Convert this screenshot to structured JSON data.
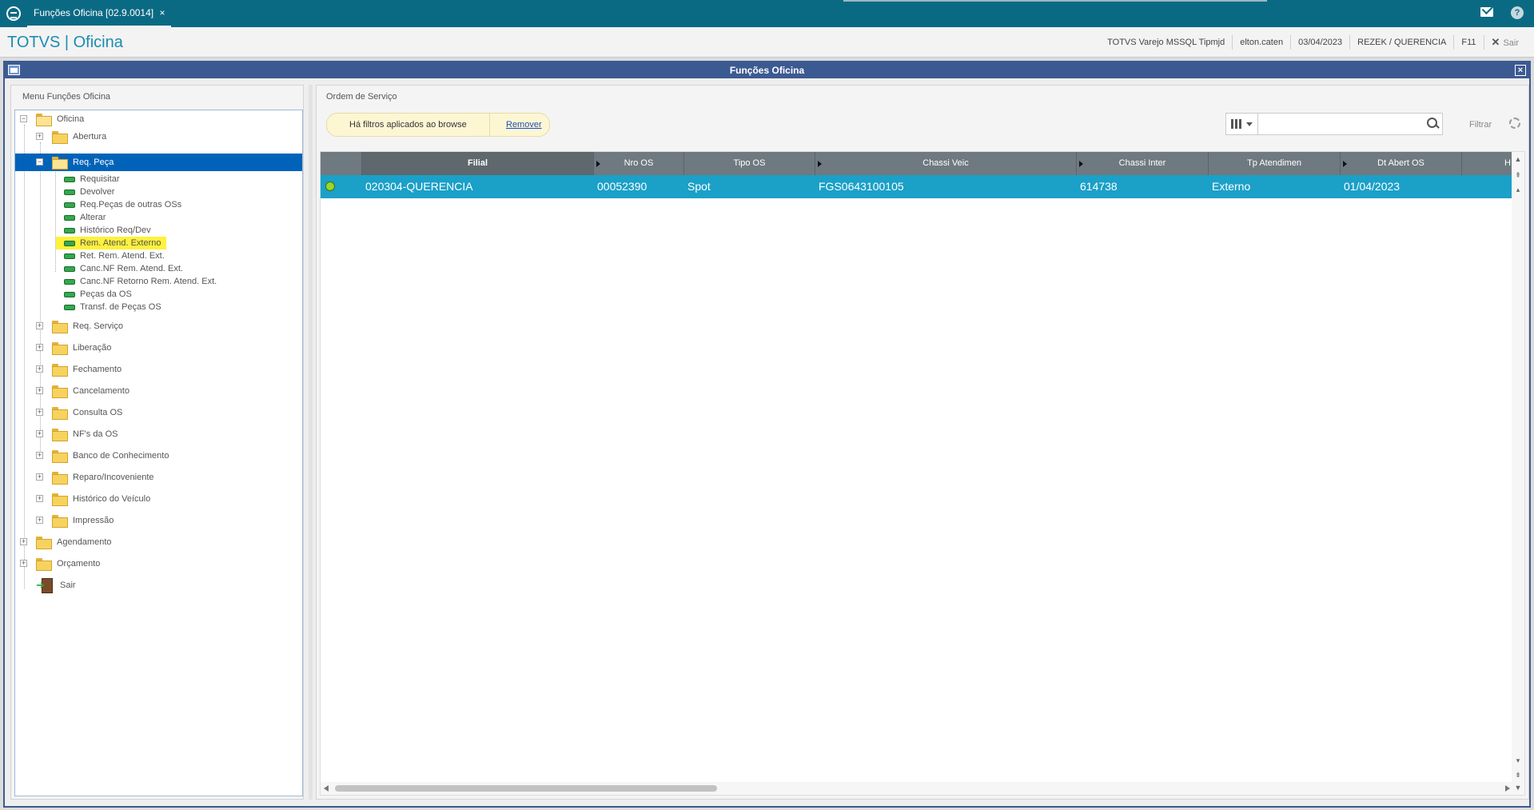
{
  "top_tab": {
    "label": "Funções Oficina [02.9.0014]",
    "close": "×"
  },
  "header": {
    "brand": "TOTVS | Oficina",
    "environment": "TOTVS Varejo MSSQL Tipmjd",
    "user": "elton.caten",
    "date": "03/04/2023",
    "branch": "REZEK / QUERENCIA",
    "shortcut": "F11",
    "exit_label": "Sair",
    "exit_icon": "✕"
  },
  "window": {
    "title": "Funções Oficina",
    "close": "×"
  },
  "left_panel": {
    "title": "Menu Funções Oficina",
    "tree": {
      "root": "Oficina",
      "abertura": "Abertura",
      "req_peca": "Req. Peça",
      "req_peca_items": [
        "Requisitar",
        "Devolver",
        "Req.Peças de outras OSs",
        "Alterar",
        "Histórico Req/Dev",
        "Rem. Atend. Externo",
        "Ret. Rem. Atend. Ext.",
        "Canc.NF Rem. Atend. Ext.",
        "Canc.NF Retorno Rem. Atend. Ext.",
        "Peças da OS",
        "Transf. de Peças OS"
      ],
      "subfolders": [
        "Req. Serviço",
        "Liberação",
        "Fechamento",
        "Cancelamento",
        "Consulta OS",
        "NF's da OS",
        "Banco de Conhecimento",
        "Reparo/Incoveniente",
        "Histórico do Veículo",
        "Impressão"
      ],
      "agendamento": "Agendamento",
      "orcamento": "Orçamento",
      "sair": "Sair"
    }
  },
  "right_panel": {
    "title": "Ordem de Serviço",
    "filter_message": "Há filtros aplicados ao browse",
    "remove_link": "Remover",
    "search_placeholder": "",
    "filter_button": "Filtrar",
    "columns": [
      "Filial",
      "Nro OS",
      "Tipo OS",
      "Chassi Veic",
      "Chassi Inter",
      "Tp Atendimen",
      "Dt Abert OS",
      "H"
    ],
    "rows": [
      {
        "filial": "020304-QUERENCIA",
        "nro_os": "00052390",
        "tipo_os": "Spot",
        "chassi_veic": "FGS0643100105",
        "chassi_inter": "614738",
        "tp_atendimen": "Externo",
        "dt_abert_os": "01/04/2023"
      }
    ]
  },
  "colors": {
    "topbar": "#0b6a83",
    "brand": "#1b8cb1",
    "window_title": "#3c5a92",
    "tree_selection": "#0063b9",
    "grid_header": "#6f7a80",
    "grid_selected_row": "#1ba0c8",
    "highlight": "#fff13c"
  }
}
